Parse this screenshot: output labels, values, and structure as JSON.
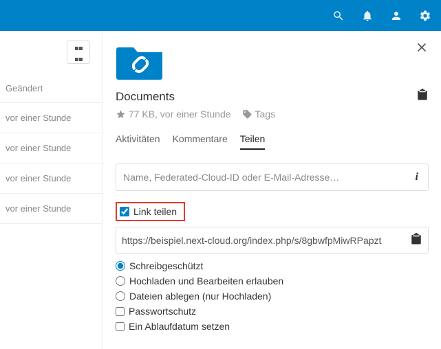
{
  "left": {
    "header": "Geändert",
    "rows": [
      "vor einer Stunde",
      "vor einer Stunde",
      "vor einer Stunde",
      "vor einer Stunde"
    ]
  },
  "panel": {
    "title": "Documents",
    "meta": "77 KB, vor einer Stunde",
    "tags_label": "Tags"
  },
  "tabs": {
    "t0": "Aktivitäten",
    "t1": "Kommentare",
    "t2": "Teilen"
  },
  "share": {
    "search_placeholder": "Name, Federated-Cloud-ID oder E-Mail-Adresse…",
    "link_label": "Link teilen",
    "url": "https://beispiel.next-cloud.org/index.php/s/8gbwfpMiwRPapzt",
    "opt_readonly": "Schreibgeschützt",
    "opt_upload_edit": "Hochladen und Bearbeiten erlauben",
    "opt_drop": "Dateien ablegen (nur Hochladen)",
    "opt_password": "Passwortschutz",
    "opt_expire": "Ein Ablaufdatum setzen"
  }
}
